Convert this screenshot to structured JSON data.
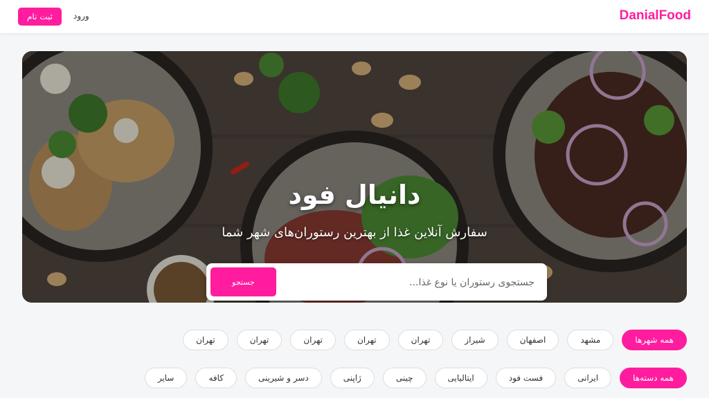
{
  "header": {
    "brand": "DanialFood",
    "login_label": "ورود",
    "register_label": "ثبت نام"
  },
  "hero": {
    "title": "دانیال فود",
    "subtitle": "سفارش آنلاین غذا از بهترین رستوران‌های شهر شما",
    "search_placeholder": "جستجوی رستوران یا نوع غذا...",
    "search_button": "جستجو"
  },
  "cities": [
    {
      "label": "همه شهرها",
      "active": true
    },
    {
      "label": "مشهد",
      "active": false
    },
    {
      "label": "اصفهان",
      "active": false
    },
    {
      "label": "شیراز",
      "active": false
    },
    {
      "label": "تهران",
      "active": false
    },
    {
      "label": "تهران",
      "active": false
    },
    {
      "label": "تهران",
      "active": false
    },
    {
      "label": "تهران",
      "active": false
    },
    {
      "label": "تهران",
      "active": false
    }
  ],
  "categories": [
    {
      "label": "همه دسته‌ها",
      "active": true
    },
    {
      "label": "ایرانی",
      "active": false
    },
    {
      "label": "فست فود",
      "active": false
    },
    {
      "label": "ایتالیایی",
      "active": false
    },
    {
      "label": "چینی",
      "active": false
    },
    {
      "label": "ژاپنی",
      "active": false
    },
    {
      "label": "دسر و شیرینی",
      "active": false
    },
    {
      "label": "کافه",
      "active": false
    },
    {
      "label": "سایر",
      "active": false
    }
  ],
  "colors": {
    "accent": "#ff1c9e",
    "page_background": "#f5f6f8"
  }
}
